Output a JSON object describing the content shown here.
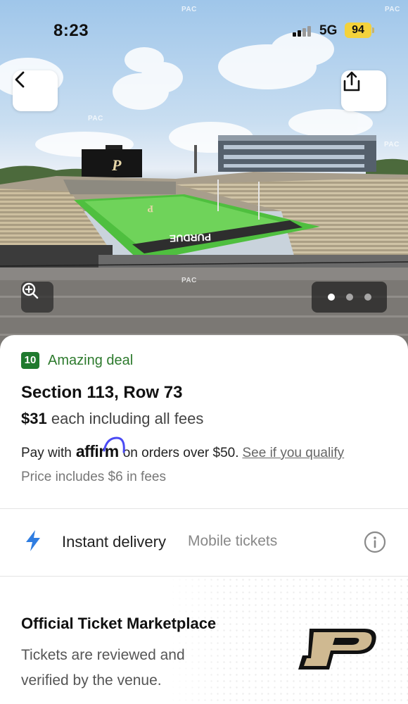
{
  "status_bar": {
    "time": "8:23",
    "network": "5G",
    "battery": "94"
  },
  "hero": {
    "watermark": "PAC",
    "scoreboard_letter": "P",
    "endzone_text": "PURDUE",
    "carousel": {
      "total": 3,
      "active": 1
    }
  },
  "icons": {
    "back": "chevron-left-icon",
    "share": "share-icon",
    "zoom": "zoom-in-icon",
    "delivery": "lightning-bolt-icon",
    "info": "info-icon",
    "logo": "purdue-p-logo"
  },
  "listing": {
    "deal_score": "10",
    "deal_label": "Amazing deal",
    "section_row": "Section 113, Row 73",
    "price": "$31",
    "price_suffix": "each including all fees",
    "affirm_prefix": "Pay with",
    "affirm_brand": "affirm",
    "affirm_suffix": "on orders over $50.",
    "affirm_link": "See if you qualify",
    "fees_note": "Price includes $6 in fees"
  },
  "delivery": {
    "label": "Instant delivery",
    "type": "Mobile tickets"
  },
  "official": {
    "title": "Official Ticket Marketplace",
    "description": "Tickets are reviewed and verified by the venue."
  },
  "colors": {
    "deal_green": "#1f7a2e",
    "bolt_blue": "#2f7de1",
    "purdue_gold": "#cfb991",
    "battery_yellow": "#f4d23b"
  }
}
